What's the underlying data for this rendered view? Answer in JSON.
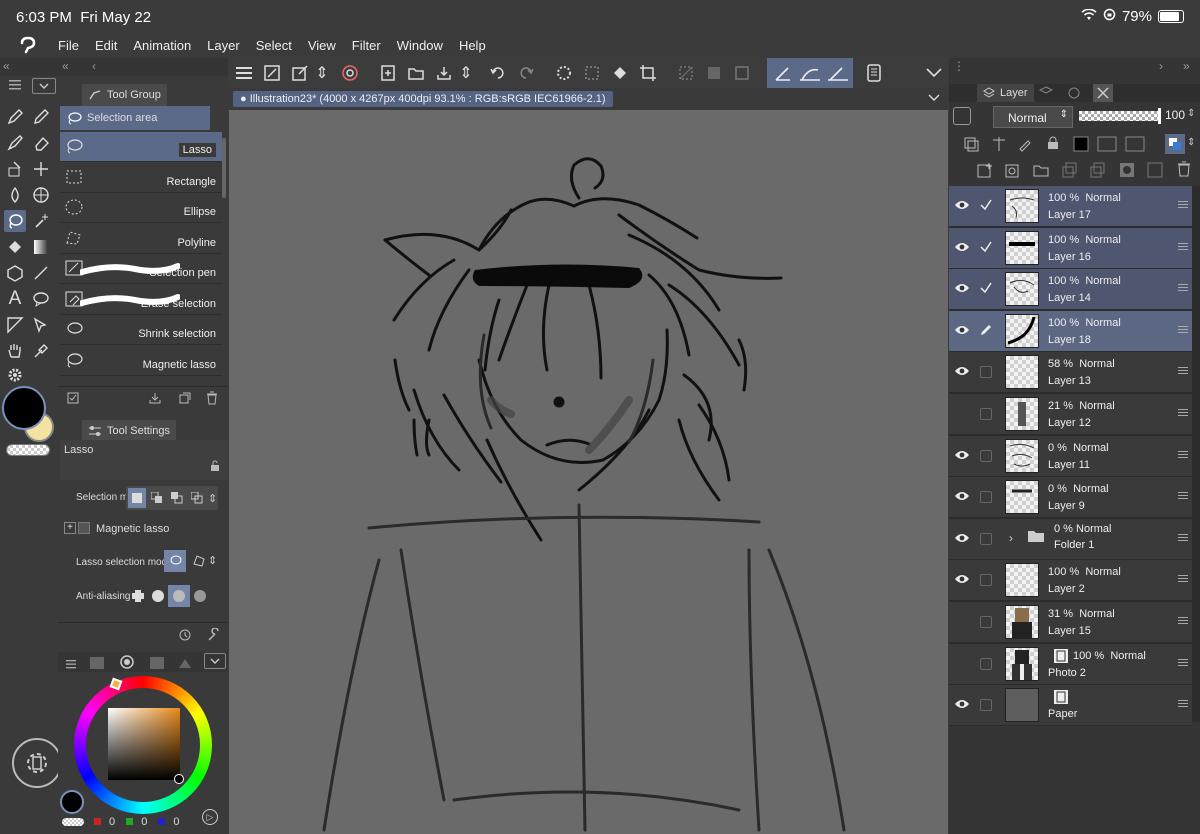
{
  "status": {
    "time": "6:03 PM",
    "date": "Fri May 22",
    "battery": "79%",
    "battery_fraction": 0.79
  },
  "menu": [
    "File",
    "Edit",
    "Animation",
    "Layer",
    "Select",
    "View",
    "Filter",
    "Window",
    "Help"
  ],
  "tool_group": {
    "tab": "Tool Group",
    "header": "Selection area",
    "items": [
      {
        "label": "Lasso",
        "selected": true
      },
      {
        "label": "Rectangle"
      },
      {
        "label": "Ellipse"
      },
      {
        "label": "Polyline"
      },
      {
        "label": "Selection pen"
      },
      {
        "label": "Erase selection"
      },
      {
        "label": "Shrink selection"
      },
      {
        "label": "Magnetic lasso"
      }
    ]
  },
  "tool_settings": {
    "tab": "Tool Settings",
    "name": "Lasso",
    "selection_mode_label": "Selection mo",
    "magnetic_lasso": "Magnetic lasso",
    "lasso_mode_label": "Lasso selection mode",
    "antialias_label": "Anti-aliasing"
  },
  "color": {
    "main": "#000000",
    "sub": "#f4e3a0",
    "rgb": [
      "0",
      "0",
      "0"
    ]
  },
  "document": {
    "title": "Illustration23* (4000 x 4267px 400dpi 93.1% : RGB:sRGB IEC61966-2.1)"
  },
  "layer_panel": {
    "tab": "Layer",
    "blend": "Normal",
    "opacity": "100",
    "layers": [
      {
        "opacity": "100 %",
        "blend": "Normal",
        "name": "Layer 17",
        "visible": true,
        "check": "check"
      },
      {
        "opacity": "100 %",
        "blend": "Normal",
        "name": "Layer 16",
        "visible": true,
        "check": "check"
      },
      {
        "opacity": "100 %",
        "blend": "Normal",
        "name": "Layer 14",
        "visible": true,
        "check": "check"
      },
      {
        "opacity": "100 %",
        "blend": "Normal",
        "name": "Layer 18",
        "visible": true,
        "check": "pen",
        "selected": true
      },
      {
        "opacity": "58 %",
        "blend": "Normal",
        "name": "Layer 13",
        "visible": true
      },
      {
        "opacity": "21 %",
        "blend": "Normal",
        "name": "Layer 12",
        "visible": false
      },
      {
        "opacity": "0 %",
        "blend": "Normal",
        "name": "Layer 11",
        "visible": true
      },
      {
        "opacity": "0 %",
        "blend": "Normal",
        "name": "Layer 9",
        "visible": true
      },
      {
        "opacity": "0 %",
        "blend": "Normal",
        "name": "Folder 1",
        "visible": true,
        "folder": true
      },
      {
        "opacity": "100 %",
        "blend": "Normal",
        "name": "Layer 2",
        "visible": true
      },
      {
        "opacity": "31 %",
        "blend": "Normal",
        "name": "Layer 15",
        "visible": false
      },
      {
        "opacity": "100 %",
        "blend": "Normal",
        "name": "Photo 2",
        "visible": false
      },
      {
        "opacity": "",
        "blend": "",
        "name": "Paper",
        "visible": true,
        "paper": true
      }
    ]
  }
}
